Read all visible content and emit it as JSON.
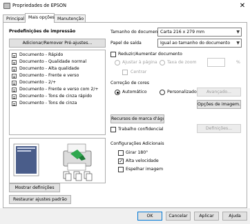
{
  "window": {
    "title": "Propriedades de EPSON",
    "close_glyph": "✕"
  },
  "tabs": [
    {
      "label": "Principal"
    },
    {
      "label": "Mais opções"
    },
    {
      "label": "Manutenção"
    }
  ],
  "left": {
    "presets_heading": "Predefinições de impressão",
    "add_remove_button": "Adicionar/Remover Pré-ajustes...",
    "presets": [
      "Documento - Rápido",
      "Documento - Qualidade normal",
      "Documento - Alta qualidade",
      "Documento - Frente e verso",
      "Documento - 2/+",
      "Documento - Frente e verso com 2/+",
      "Documento - Tons de cinza rápido",
      "Documento - Tons de cinza"
    ],
    "show_settings_button": "Mostrar definições",
    "restore_defaults_button": "Restaurar ajustes padrão"
  },
  "right": {
    "doc_size_label": "Tamanho do documento",
    "doc_size_value": "Carta 216 x 279 mm",
    "output_paper_label": "Papel de saída",
    "output_paper_value": "Igual ao tamanho do documento",
    "reduce_enlarge_label": "Reduzir/Aumentar documento",
    "fit_page_label": "Ajustar à página",
    "zoom_label": "Taxa de zoom",
    "percent": "%",
    "center_label": "Centrar",
    "color_correction_label": "Correção de cores",
    "automatic_label": "Automático",
    "custom_label": "Personalizado",
    "advanced_button": "Avançado...",
    "image_options_button": "Opções de imagem...",
    "watermark_button": "Recursos de marca d'água",
    "confidential_label": "Trabalho confidencial",
    "definitions_button": "Definições...",
    "additional_settings_label": "Configurações Adicionais",
    "rotate_label": "Girar 180°",
    "high_speed_label": "Alta velocidade",
    "mirror_label": "Espelhar imagem",
    "check_glyph": "✓"
  },
  "footer": {
    "ok": "OK",
    "cancel": "Cancelar",
    "apply": "Aplicar",
    "help": "Ajuda"
  }
}
